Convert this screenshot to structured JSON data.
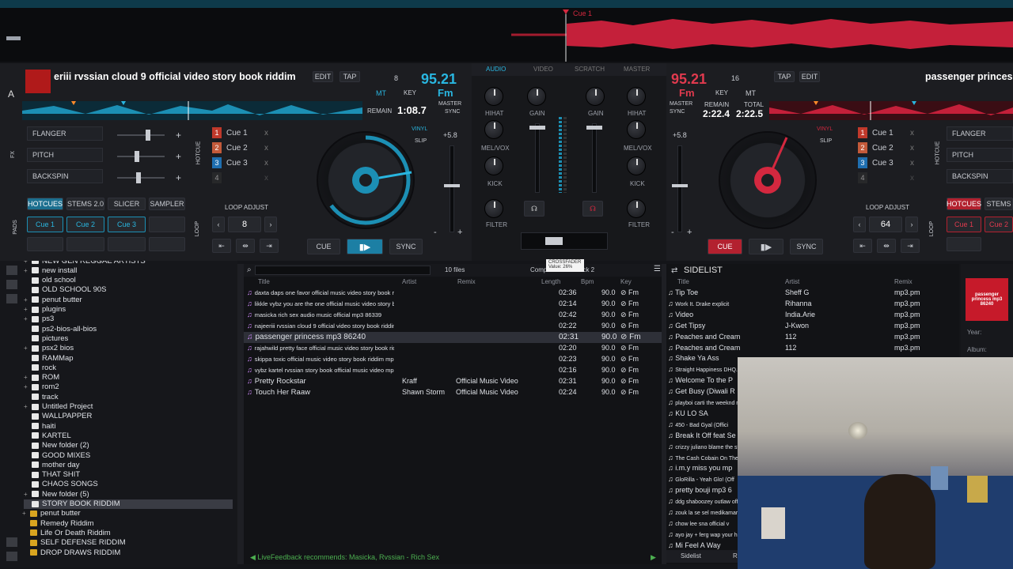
{
  "top": {
    "cue_label": "Cue 1"
  },
  "left_deck": {
    "deck_letter": "A",
    "title": "eriii rvssian cloud 9 official video story book riddim",
    "edit": "EDIT",
    "tap": "TAP",
    "bpm": "95.21",
    "key_num": "8",
    "key": "Fm",
    "mt": "MT",
    "key_lbl": "KEY",
    "remain_lbl": "REMAIN",
    "remain": "1:08.7",
    "master": "MASTER",
    "sync_lbl": "SYNC",
    "fx": [
      "FLANGER",
      "PITCH",
      "BACKSPIN"
    ],
    "fx_lbl": "FX",
    "hotcue_lbl": "HOTCUE",
    "cues": [
      {
        "n": "1",
        "name": "Cue 1",
        "x": "x"
      },
      {
        "n": "2",
        "name": "Cue 2",
        "x": "x"
      },
      {
        "n": "3",
        "name": "Cue 3",
        "x": "x"
      },
      {
        "n": "4",
        "name": "",
        "x": "x"
      }
    ],
    "vinyl": "VINYL",
    "slip": "SLIP",
    "pitch_val": "+5.8",
    "pad_tabs": [
      "HOTCUES",
      "STEMS 2.0",
      "SLICER",
      "SAMPLER"
    ],
    "pads_lbl": "PADS",
    "pads": [
      "Cue 1",
      "Cue 2",
      "Cue 3"
    ],
    "loop_adjust": "LOOP ADJUST",
    "loop_lbl": "LOOP",
    "loop_val": "8",
    "cue": "CUE",
    "sync": "SYNC",
    "minus": "-",
    "plus": "+"
  },
  "mixer": {
    "tabs": [
      "AUDIO",
      "VIDEO",
      "SCRATCH",
      "MASTER"
    ],
    "labels": {
      "hihat": "HIHAT",
      "melvox": "MEL/VOX",
      "kick": "KICK",
      "filter": "FILTER",
      "gain": "GAIN"
    },
    "crossfader": "CROSSFADER",
    "crossfader_val": "Value: 26%"
  },
  "right_deck": {
    "title": "passenger princess",
    "bpm": "95.21",
    "key_num": "16",
    "key": "Fm",
    "key_lbl": "KEY",
    "mt": "MT",
    "tap": "TAP",
    "edit": "EDIT",
    "master": "MASTER",
    "sync_lbl": "SYNC",
    "remain_lbl": "REMAIN",
    "remain": "2:22.4",
    "total_lbl": "TOTAL",
    "total": "2:22.5",
    "pitch_val": "+5.8",
    "vinyl": "VINYL",
    "slip": "SLIP",
    "cues": [
      {
        "n": "1",
        "name": "Cue 1",
        "x": "x"
      },
      {
        "n": "2",
        "name": "Cue 2",
        "x": "x"
      },
      {
        "n": "3",
        "name": "Cue 3",
        "x": "x"
      },
      {
        "n": "4",
        "name": "",
        "x": "x"
      }
    ],
    "hotcue_lbl": "HOTCUE",
    "fx": [
      "FLANGER",
      "PITCH",
      "BACKSPIN"
    ],
    "pad_tabs": [
      "HOTCUES",
      "STEMS"
    ],
    "pads": [
      "Cue 1",
      "Cue 2"
    ],
    "loop_adjust": "LOOP ADJUST",
    "loop_lbl": "LOOP",
    "loop_val": "64",
    "cue": "CUE",
    "sync": "SYNC",
    "minus": "-",
    "plus": "+"
  },
  "tree": [
    {
      "name": "NEW GEN REGGAE ARTISTS",
      "exp": "+",
      "c": "w"
    },
    {
      "name": "new install",
      "exp": "+",
      "c": "w"
    },
    {
      "name": "old school",
      "exp": "",
      "c": "w"
    },
    {
      "name": "OLD SCHOOL 90S",
      "exp": "",
      "c": "w"
    },
    {
      "name": "penut butter",
      "exp": "+",
      "c": "w"
    },
    {
      "name": "plugins",
      "exp": "+",
      "c": "w"
    },
    {
      "name": "ps3",
      "exp": "+",
      "c": "w"
    },
    {
      "name": "ps2-bios-all-bios",
      "exp": "",
      "c": "w"
    },
    {
      "name": "pictures",
      "exp": "",
      "c": "w"
    },
    {
      "name": "psx2 bios",
      "exp": "+",
      "c": "w"
    },
    {
      "name": "RAMMap",
      "exp": "",
      "c": "w"
    },
    {
      "name": "rock",
      "exp": "",
      "c": "w"
    },
    {
      "name": "ROM",
      "exp": "+",
      "c": "w"
    },
    {
      "name": "rom2",
      "exp": "+",
      "c": "w"
    },
    {
      "name": "track",
      "exp": "",
      "c": "w"
    },
    {
      "name": "Untitled Project",
      "exp": "+",
      "c": "w"
    },
    {
      "name": "WALLPAPPER",
      "exp": "",
      "c": "w"
    },
    {
      "name": "haiti",
      "exp": "",
      "c": "w"
    },
    {
      "name": "KARTEL",
      "exp": "",
      "c": "w"
    },
    {
      "name": "New folder (2)",
      "exp": "",
      "c": "w"
    },
    {
      "name": "GOOD MIXES",
      "exp": "",
      "c": "w"
    },
    {
      "name": "mother day",
      "exp": "",
      "c": "w"
    },
    {
      "name": "THAT SHIT",
      "exp": "",
      "c": "w"
    },
    {
      "name": "CHAOS SONGS",
      "exp": "",
      "c": "w"
    },
    {
      "name": "New folder (5)",
      "exp": "+",
      "c": "w"
    },
    {
      "name": "STORY BOOK RIDDIM",
      "exp": "",
      "c": "w",
      "sel": true
    },
    {
      "name": "penut butter",
      "exp": "+",
      "c": "y",
      "l": 1
    },
    {
      "name": "Remedy Riddim",
      "exp": "",
      "c": "y",
      "l": 1
    },
    {
      "name": "Life Or Death Riddim",
      "exp": "",
      "c": "y",
      "l": 1
    },
    {
      "name": "SELF DEFENSE RIDDIM",
      "exp": "",
      "c": "y",
      "l": 1
    },
    {
      "name": "DROP DRAWS RIDDIM",
      "exp": "",
      "c": "y",
      "l": 1
    }
  ],
  "files": {
    "count": "10 files",
    "comp": "Comp",
    "deck2": "eck 2",
    "cols": {
      "title": "Title",
      "artist": "Artist",
      "remix": "Remix",
      "length": "Length",
      "bpm": "Bpm",
      "key": "Key"
    },
    "rows": [
      {
        "title": "daxta daps one favor official music video story book riddim m...",
        "artist": "",
        "remix": "",
        "length": "02:36",
        "bpm": "90.0",
        "key": "Fm"
      },
      {
        "title": "likkle vybz you are the one official music video story book ridd...",
        "artist": "",
        "remix": "",
        "length": "02:14",
        "bpm": "90.0",
        "key": "Fm"
      },
      {
        "title": "masicka rich sex audio music official mp3 86339",
        "artist": "",
        "remix": "",
        "length": "02:42",
        "bpm": "90.0",
        "key": "Fm"
      },
      {
        "title": "najeeriii rvssian cloud 9 official video story book riddim mp3 120",
        "artist": "",
        "remix": "",
        "length": "02:22",
        "bpm": "90.0",
        "key": "Fm"
      },
      {
        "title": "passenger princess mp3 86240",
        "artist": "",
        "remix": "",
        "length": "02:31",
        "bpm": "90.0",
        "key": "Fm",
        "sel": true
      },
      {
        "title": "rajahwild pretty face official music video story book riddim mp...",
        "artist": "",
        "remix": "",
        "length": "02:20",
        "bpm": "90.0",
        "key": "Fm"
      },
      {
        "title": "skippa toxic official music video story book riddim mp3 132",
        "artist": "",
        "remix": "",
        "length": "02:23",
        "bpm": "90.0",
        "key": "Fm"
      },
      {
        "title": "vybz kartel rvssian story book official music video mp3 21067",
        "artist": "",
        "remix": "",
        "length": "02:16",
        "bpm": "90.0",
        "key": "Fm"
      },
      {
        "title": "Pretty Rockstar",
        "artist": "Kraff",
        "remix": "Official Music Video",
        "length": "02:31",
        "bpm": "90.0",
        "key": "Fm"
      },
      {
        "title": "Touch Her Raaw",
        "artist": "Shawn Storm",
        "remix": "Official Music Video",
        "length": "02:24",
        "bpm": "90.0",
        "key": "Fm"
      }
    ],
    "feedback": "LiveFeedback recommends: Masicka, Rvssian - Rich Sex"
  },
  "sidelist": {
    "title": "SIDELIST",
    "cols": {
      "title": "Title",
      "artist": "Artist",
      "remix": "Remix"
    },
    "rows": [
      {
        "title": "Tip Toe",
        "artist": "Sheff G",
        "remix": "mp3.pm"
      },
      {
        "title": "Work It. Drake explicit",
        "artist": "Rihanna",
        "remix": "mp3.pm"
      },
      {
        "title": "Video",
        "artist": "India.Arie",
        "remix": "mp3.pm"
      },
      {
        "title": "Get Tipsy",
        "artist": "J-Kwon",
        "remix": "mp3.pm"
      },
      {
        "title": "Peaches and Cream",
        "artist": "112",
        "remix": "mp3.pm"
      },
      {
        "title": "Peaches and Cream",
        "artist": "112",
        "remix": "mp3.pm"
      },
      {
        "title": "Shake Ya Ass",
        "artist": "",
        "remix": ""
      },
      {
        "title": "Straight Happiness DHQ.su",
        "artist": "",
        "remix": ""
      },
      {
        "title": "Welcome To the P",
        "artist": "",
        "remix": ""
      },
      {
        "title": "Get Busy (Diwali R",
        "artist": "",
        "remix": ""
      },
      {
        "title": "playboi carti the weeknd rat",
        "artist": "",
        "remix": ""
      },
      {
        "title": "KU LO SA",
        "artist": "",
        "remix": ""
      },
      {
        "title": "450 - Bad Gyal (Offici",
        "artist": "",
        "remix": ""
      },
      {
        "title": "Break It Off feat Se",
        "artist": "",
        "remix": ""
      },
      {
        "title": "crizzy juliano blame the stre",
        "artist": "",
        "remix": ""
      },
      {
        "title": "The Cash Cobain On The F",
        "artist": "",
        "remix": ""
      },
      {
        "title": "i.m.y miss you mp",
        "artist": "",
        "remix": ""
      },
      {
        "title": "GloRilla - Yeah Glo! (Off",
        "artist": "",
        "remix": ""
      },
      {
        "title": "pretty bouji mp3 6",
        "artist": "",
        "remix": ""
      },
      {
        "title": "ddg shaboozey outlaw offic",
        "artist": "",
        "remix": ""
      },
      {
        "title": "zouk la se sel medikamar",
        "artist": "",
        "remix": ""
      },
      {
        "title": "chow lee sna official v",
        "artist": "",
        "remix": ""
      },
      {
        "title": "ayo jay + ferg wap your hu",
        "artist": "",
        "remix": ""
      },
      {
        "title": "Mi Feel A Way",
        "artist": "",
        "remix": ""
      }
    ],
    "tab": "Sidelist",
    "tab2": "R"
  },
  "info": {
    "art_text": "passenger princess mp3 86240",
    "year": "Year:",
    "album": "Album:"
  },
  "colors": {
    "blue": "#1c8fb4",
    "red": "#d4283f",
    "cyan": "#29b6e0"
  }
}
